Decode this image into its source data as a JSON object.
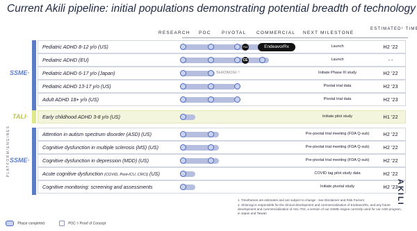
{
  "title": "Current Akili pipeline: initial populations demonstrating potential breadth of technology",
  "columns": {
    "research": "RESEARCH",
    "poc": "POC",
    "pivotal": "PIVOTAL",
    "commercial": "COMMERCIAL",
    "next_milestone": "NEXT MILESTONE",
    "timeframe": "ESTIMATED¹ TIMEFRAME"
  },
  "side_label": "PLATFORM/ENGINES",
  "groups": {
    "sme1": "SSME·",
    "tali": "TALI·",
    "sme2": "SSME·"
  },
  "rows": [
    {
      "label": "Pediatric ADHD 8-12 y/o (US)",
      "milestone": "Launch",
      "timeframe": "H2 '22",
      "stage_progress": 1.0
    },
    {
      "label": "Pediatric ADHD (EU)",
      "milestone": "Launch",
      "timeframe": "- -",
      "stage_progress": 1.0
    },
    {
      "label": "Pediatric ADHD 6-17 y/o (Japan)",
      "milestone": "Initiate Phase III study",
      "timeframe": "H2 '22",
      "stage_progress": 0.35
    },
    {
      "label": "Pediatric ADHD 13-17 y/o (US)",
      "milestone": "Pivotal trial data",
      "timeframe": "H2 '23",
      "stage_progress": 0.6
    },
    {
      "label": "Adult ADHD 18+ y/o (US)",
      "milestone": "Pivotal trial data",
      "timeframe": "H2 '23",
      "stage_progress": 0.6
    },
    {
      "label": "Early childhood ADHD 3-8 y/o (US)",
      "milestone": "Initiate pilot study",
      "timeframe": "H1 '22",
      "stage_progress": 0.1
    },
    {
      "label": "Attention in autism spectrum disorder (ASD) (US)",
      "milestone": "Pre-pivotal trial meeting (FDA Q-sub)",
      "timeframe": "H2 '22",
      "stage_progress": 0.4
    },
    {
      "label": "Cognitive dysfunction in multiple sclerosis (MS) (US)",
      "milestone": "Pre-pivotal trial meeting (FDA Q-sub)",
      "timeframe": "H2 '22",
      "stage_progress": 0.4
    },
    {
      "label": "Cognitive dysfunction in depression (MDD) (US)",
      "milestone": "Pre-pivotal trial meeting (FDA Q-sub)",
      "timeframe": "H2 '22",
      "stage_progress": 0.4
    },
    {
      "label": "Acute cognitive dysfunction",
      "label_small": "(COVID, Post-ICU, CRCI)",
      "label_tail": " (US)",
      "milestone": "COVID tag pilot study data",
      "timeframe": "H2 '22",
      "stage_progress": 0.1
    },
    {
      "label": "Cognitive monitoring: screening and assessments",
      "milestone": "Initiate pivotal study",
      "timeframe": "H2 '23",
      "stage_progress": 0.0
    }
  ],
  "badges": {
    "fda": "FDA",
    "ce": "CE",
    "endeavor": "EndeavorRx",
    "shionogi": "SHIONOGI ²"
  },
  "legend": {
    "phase_completed": "Phase completed",
    "poc_def": "POC = Proof of Concept"
  },
  "notes": [
    "1. Timeframes are estimates and are subject to change - see Disclaimer and Risk Factors",
    "2. Shionogi is responsible for the clinical development and commercialization of EndeavorRx, and any future development and commercialization of AKL-T02, a version of our SSME engine currently used for our ASD program, in Japan and Taiwan"
  ],
  "logo": "AKILI",
  "colors": {
    "accent": "#5b7cc9",
    "bar": "#b6bee0",
    "tali_band": "#e1e88a"
  }
}
